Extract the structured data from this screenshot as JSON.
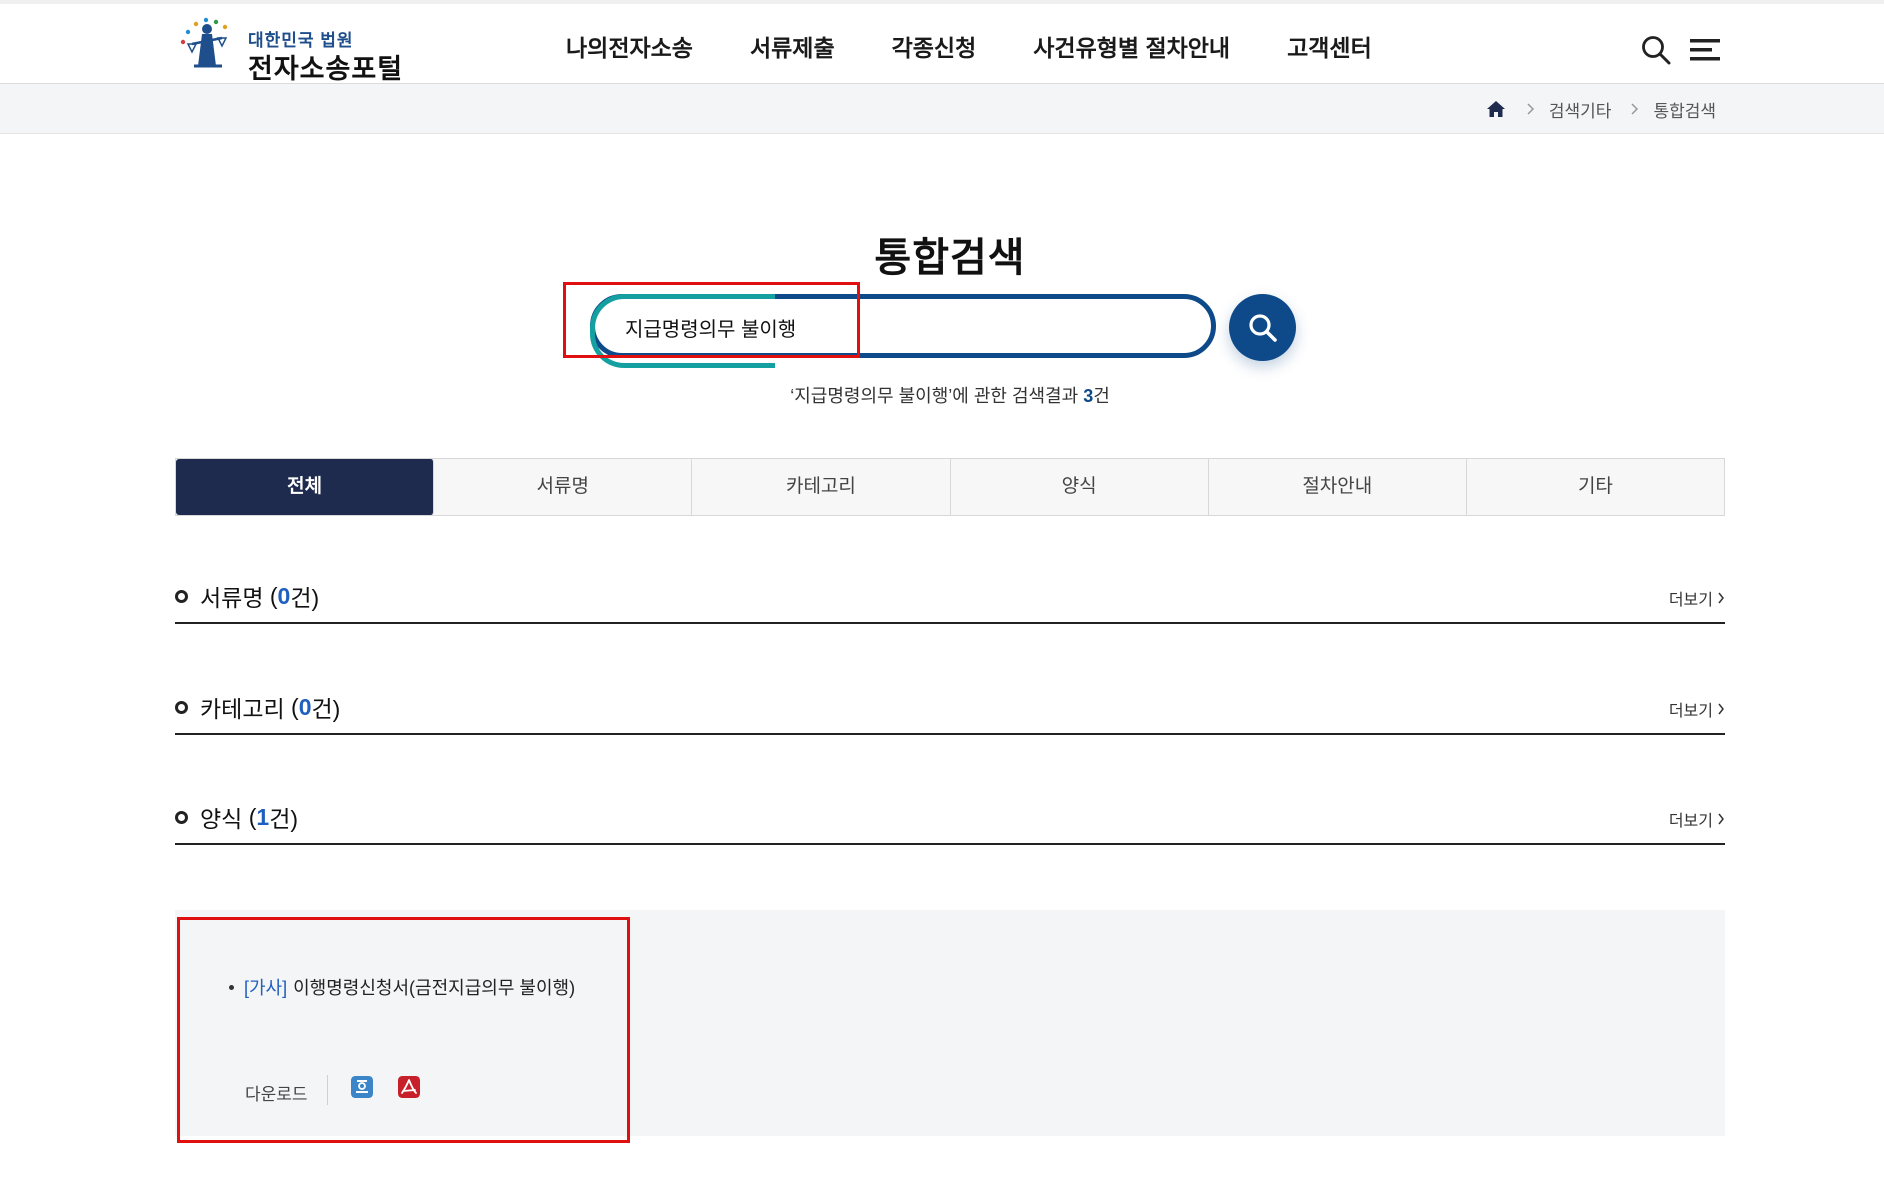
{
  "header": {
    "logo_small": "대한민국 법원",
    "logo_big": "전자소송포털",
    "nav": [
      "나의전자소송",
      "서류제출",
      "각종신청",
      "사건유형별 절차안내",
      "고객센터"
    ]
  },
  "breadcrumb": {
    "items": [
      "검색기타",
      "통합검색"
    ]
  },
  "search": {
    "title": "통합검색",
    "query": "지급명령의무 불이행",
    "summary_prefix": "‘지급명령의무 불이행’에 관한 검색결과 ",
    "summary_count": "3",
    "summary_suffix": "건"
  },
  "tabs": [
    {
      "label": "전체",
      "active": true
    },
    {
      "label": "서류명",
      "active": false
    },
    {
      "label": "카테고리",
      "active": false
    },
    {
      "label": "양식",
      "active": false
    },
    {
      "label": "절차안내",
      "active": false
    },
    {
      "label": "기타",
      "active": false
    }
  ],
  "sections": [
    {
      "name": "서류명",
      "count": "0",
      "more": "더보기"
    },
    {
      "name": "카테고리",
      "count": "0",
      "more": "더보기"
    },
    {
      "name": "양식",
      "count": "1",
      "more": "더보기"
    }
  ],
  "form_result": {
    "category": "[가사]",
    "title": "이행명령신청서(금전지급의무 불이행)",
    "download_label": "다운로드",
    "files": [
      "hwp-file-icon",
      "pdf-file-icon"
    ]
  },
  "colors": {
    "brand_navy": "#0e4a8a",
    "tab_active": "#1e2b4f",
    "accent_teal": "#14a0a0",
    "count_blue": "#1f5fbf",
    "annotation_red": "#e01010"
  }
}
